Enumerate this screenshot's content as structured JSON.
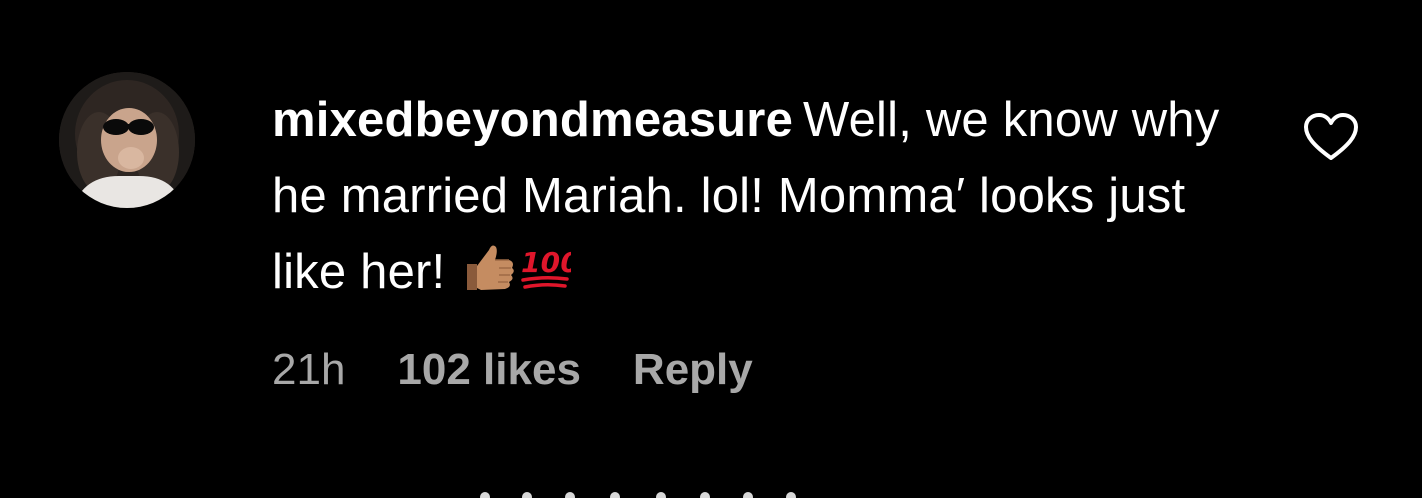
{
  "comment": {
    "username": "mixedbeyondmeasure",
    "text": "Well, we know why he married Mariah. lol! Momma′ looks just like her!",
    "emojis": [
      "thumbs-up-icon",
      "hundred-points-icon"
    ],
    "timestamp": "21h",
    "likes": "102 likes",
    "reply_label": "Reply"
  },
  "colors": {
    "background": "#000000",
    "text": "#ffffff",
    "meta": "#a8a8a8"
  },
  "icons": {
    "like": "heart-outline-icon"
  }
}
